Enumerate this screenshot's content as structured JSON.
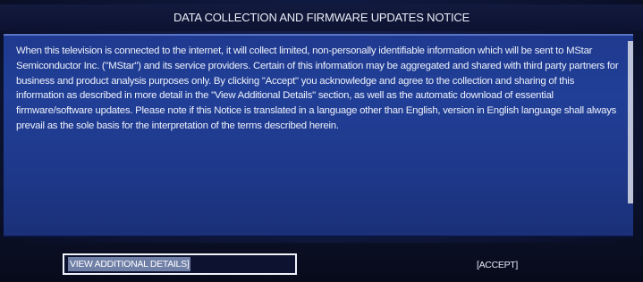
{
  "dialog": {
    "title": "DATA COLLECTION AND FIRMWARE UPDATES NOTICE",
    "body": "When this television is connected to the internet, it will collect limited, non-personally identifiable information which will be sent to MStar Semiconductor Inc. (\"MStar\") and its service providers. Certain of this information may be aggregated and shared with third party partners for business and product analysis purposes only. By clicking \"Accept\" you acknowledge and agree to the collection and sharing of this information as described in more detail in the \"View Additional Details\" section, as well as the automatic download of essential firmware/software updates. Please note if this Notice is translated in a language other than English, version in English language shall always prevail as the sole basis for the interpretation of the terms described herein."
  },
  "buttons": {
    "view_details_label": "VIEW ADDITIONAL DETAILS]",
    "accept_label": "[ACCEPT]"
  },
  "colors": {
    "panel_blue": "#213f97",
    "background_dark": "#0c1230",
    "text": "#eef1fb",
    "focus_border": "#f2f4fb"
  }
}
